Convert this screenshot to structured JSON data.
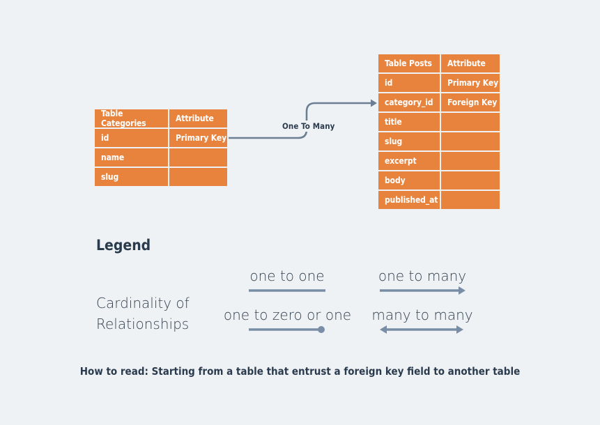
{
  "theme": {
    "background": "#eff2f5",
    "table_fill": "#e8833e",
    "table_text": "#ffffff",
    "connector": "#6b7e94",
    "text_dark": "#2b3b4e"
  },
  "tables": [
    {
      "id": "categories",
      "header": {
        "name": "Table Categories",
        "attribute": "Attribute"
      },
      "rows": [
        {
          "name": "id",
          "attribute": "Primary Key"
        },
        {
          "name": "name",
          "attribute": ""
        },
        {
          "name": "slug",
          "attribute": ""
        }
      ]
    },
    {
      "id": "posts",
      "header": {
        "name": "Table Posts",
        "attribute": "Attribute"
      },
      "rows": [
        {
          "name": "id",
          "attribute": "Primary Key"
        },
        {
          "name": "category_id",
          "attribute": "Foreign Key"
        },
        {
          "name": "title",
          "attribute": ""
        },
        {
          "name": "slug",
          "attribute": ""
        },
        {
          "name": "excerpt",
          "attribute": ""
        },
        {
          "name": "body",
          "attribute": ""
        },
        {
          "name": "published_at",
          "attribute": ""
        }
      ]
    }
  ],
  "relationship": {
    "label": "One To Many",
    "from": "Table Categories",
    "to": "Table Posts"
  },
  "legend": {
    "title": "Legend",
    "subject": "Cardinality of Relationships",
    "items": [
      {
        "label": "one to one",
        "symbol": "line"
      },
      {
        "label": "one to many",
        "symbol": "line-arrow-right"
      },
      {
        "label": "one to zero or one",
        "symbol": "line-dot-right"
      },
      {
        "label": "many to many",
        "symbol": "line-arrow-both"
      }
    ]
  },
  "caption": "How to read: Starting from a table that entrust a foreign key field to another table"
}
